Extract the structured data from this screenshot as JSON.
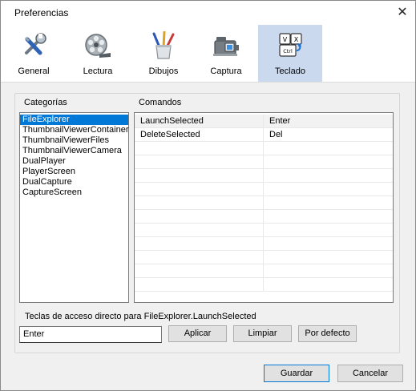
{
  "window": {
    "title": "Preferencias",
    "close_glyph": "✕"
  },
  "toolbar": {
    "tabs": [
      {
        "label": "General",
        "icon": "tools-icon"
      },
      {
        "label": "Lectura",
        "icon": "film-reel-icon"
      },
      {
        "label": "Dibujos",
        "icon": "brushes-icon"
      },
      {
        "label": "Captura",
        "icon": "camera-icon"
      },
      {
        "label": "Teclado",
        "icon": "keyboard-keys-icon"
      }
    ],
    "active": "Teclado",
    "active_color": "#cbd9ee"
  },
  "categories": {
    "label": "Categorías",
    "items": [
      "FileExplorer",
      "ThumbnailViewerContainer",
      "ThumbnailViewerFiles",
      "ThumbnailViewerCamera",
      "DualPlayer",
      "PlayerScreen",
      "DualCapture",
      "CaptureScreen"
    ],
    "selected": "FileExplorer",
    "selection_color": "#0078d7"
  },
  "commands": {
    "label": "Comandos",
    "rows": [
      {
        "command": "LaunchSelected",
        "key": "Enter"
      },
      {
        "command": "DeleteSelected",
        "key": "Del"
      }
    ]
  },
  "shortcut": {
    "label": "Teclas de acceso directo para FileExplorer.LaunchSelected",
    "value": "Enter",
    "apply_label": "Aplicar",
    "clear_label": "Limpiar",
    "default_label": "Por defecto"
  },
  "footer": {
    "save_label": "Guardar",
    "cancel_label": "Cancelar"
  }
}
